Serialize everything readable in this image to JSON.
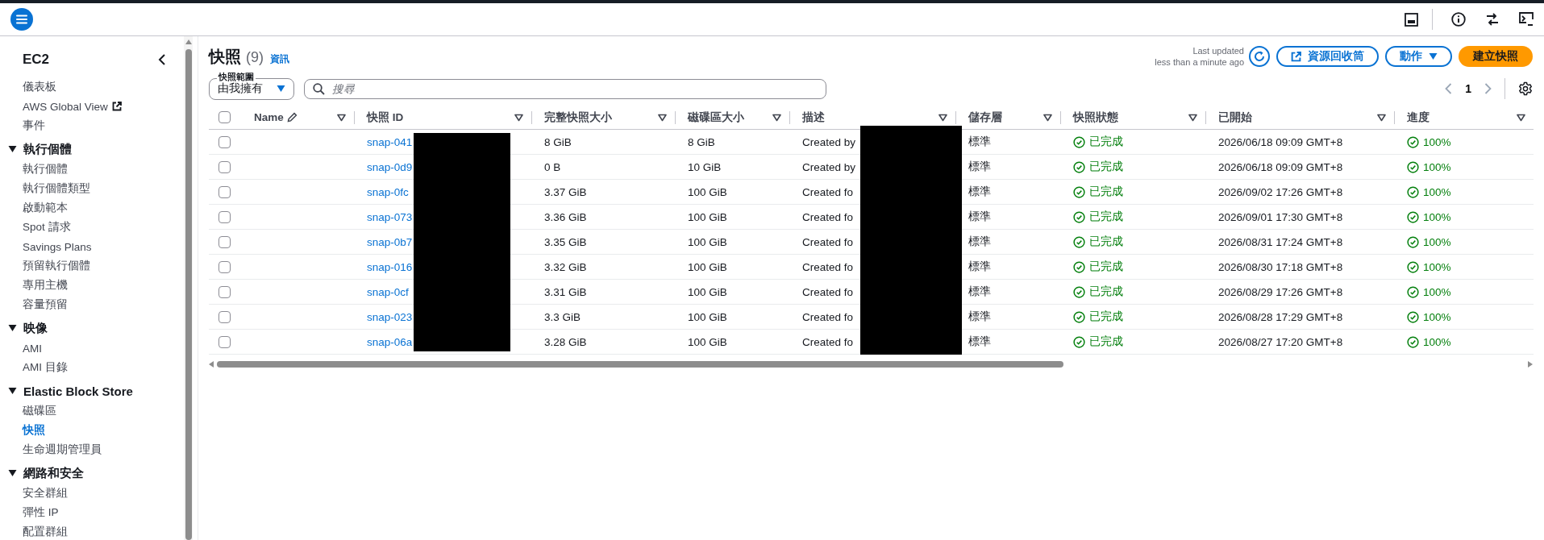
{
  "sidebar": {
    "title": "EC2",
    "items": [
      {
        "label": "儀表板",
        "selected": false,
        "kind": "link"
      },
      {
        "label": "AWS Global View",
        "selected": false,
        "kind": "external"
      },
      {
        "label": "事件",
        "selected": false,
        "kind": "link"
      }
    ],
    "groups": [
      {
        "label": "執行個體",
        "expanded": true,
        "children": [
          {
            "label": "執行個體",
            "selected": false
          },
          {
            "label": "執行個體類型",
            "selected": false
          },
          {
            "label": "啟動範本",
            "selected": false
          },
          {
            "label": "Spot 請求",
            "selected": false
          },
          {
            "label": "Savings Plans",
            "selected": false
          },
          {
            "label": "預留執行個體",
            "selected": false
          },
          {
            "label": "專用主機",
            "selected": false
          },
          {
            "label": "容量預留",
            "selected": false
          }
        ]
      },
      {
        "label": "映像",
        "expanded": true,
        "children": [
          {
            "label": "AMI",
            "selected": false
          },
          {
            "label": "AMI 目錄",
            "selected": false
          }
        ]
      },
      {
        "label": "Elastic Block Store",
        "expanded": true,
        "children": [
          {
            "label": "磁碟區",
            "selected": false
          },
          {
            "label": "快照",
            "selected": true
          },
          {
            "label": "生命週期管理員",
            "selected": false
          }
        ]
      },
      {
        "label": "網路和安全",
        "expanded": true,
        "children": [
          {
            "label": "安全群組",
            "selected": false
          },
          {
            "label": "彈性 IP",
            "selected": false
          },
          {
            "label": "配置群組",
            "selected": false
          }
        ]
      }
    ]
  },
  "header": {
    "title": "快照",
    "count": "(9)",
    "info": "資訊",
    "last_updated": [
      "Last updated",
      "less than a minute ago"
    ],
    "recycle_button": "資源回收筒",
    "actions_button": "動作",
    "create_button": "建立快照"
  },
  "filter": {
    "label": "快照範圍",
    "value": "由我擁有",
    "search_placeholder": "搜尋",
    "page": "1"
  },
  "table": {
    "select_all_checked": false,
    "columns": [
      "Name",
      "快照 ID",
      "完整快照大小",
      "磁碟區大小",
      "描述",
      "儲存層",
      "快照狀態",
      "已開始",
      "進度"
    ],
    "rows": [
      {
        "checked": false,
        "id": "snap-041",
        "full_size": "8 GiB",
        "volume_size": "8 GiB",
        "description": "Created by",
        "tier": "標準",
        "status": "已完成",
        "started": "2026/06/18 09:09 GMT+8",
        "progress": "100%"
      },
      {
        "checked": false,
        "id": "snap-0d9",
        "full_size": "0 B",
        "volume_size": "10 GiB",
        "description": "Created by",
        "tier": "標準",
        "status": "已完成",
        "started": "2026/06/18 09:09 GMT+8",
        "progress": "100%"
      },
      {
        "checked": false,
        "id": "snap-0fc",
        "full_size": "3.37 GiB",
        "volume_size": "100 GiB",
        "description": "Created fo",
        "tier": "標準",
        "status": "已完成",
        "started": "2026/09/02 17:26 GMT+8",
        "progress": "100%"
      },
      {
        "checked": false,
        "id": "snap-073",
        "full_size": "3.36 GiB",
        "volume_size": "100 GiB",
        "description": "Created fo",
        "tier": "標準",
        "status": "已完成",
        "started": "2026/09/01 17:30 GMT+8",
        "progress": "100%"
      },
      {
        "checked": false,
        "id": "snap-0b7",
        "full_size": "3.35 GiB",
        "volume_size": "100 GiB",
        "description": "Created fo",
        "tier": "標準",
        "status": "已完成",
        "started": "2026/08/31 17:24 GMT+8",
        "progress": "100%"
      },
      {
        "checked": false,
        "id": "snap-016",
        "full_size": "3.32 GiB",
        "volume_size": "100 GiB",
        "description": "Created fo",
        "tier": "標準",
        "status": "已完成",
        "started": "2026/08/30 17:18 GMT+8",
        "progress": "100%"
      },
      {
        "checked": false,
        "id": "snap-0cf",
        "full_size": "3.31 GiB",
        "volume_size": "100 GiB",
        "description": "Created fo",
        "tier": "標準",
        "status": "已完成",
        "started": "2026/08/29 17:26 GMT+8",
        "progress": "100%"
      },
      {
        "checked": false,
        "id": "snap-023",
        "full_size": "3.3 GiB",
        "volume_size": "100 GiB",
        "description": "Created fo",
        "tier": "標準",
        "status": "已完成",
        "started": "2026/08/28 17:29 GMT+8",
        "progress": "100%"
      },
      {
        "checked": false,
        "id": "snap-06a",
        "full_size": "3.28 GiB",
        "volume_size": "100 GiB",
        "description": "Created fo",
        "tier": "標準",
        "status": "已完成",
        "started": "2026/08/27 17:20 GMT+8",
        "progress": "100%"
      }
    ]
  }
}
